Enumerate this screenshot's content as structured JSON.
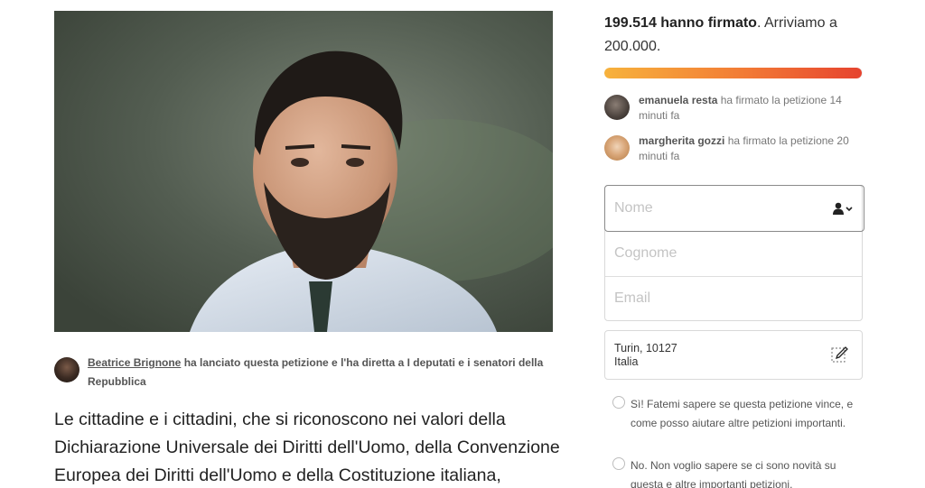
{
  "petition": {
    "starter_name": "Beatrice Brignone",
    "starter_action": " ha lanciato questa petizione e l'ha diretta a I deputati e i senatori della Repubblica",
    "body_text": "Le cittadine e i cittadini, che si riconoscono nei valori della Dichiarazione Universale dei Diritti dell'Uomo, della Convenzione Europea dei Diritti dell'Uomo e della Costituzione italiana,"
  },
  "signatures": {
    "count": "199.514 hanno firmato",
    "goal_text": ". Arriviamo a 200.000.",
    "progress_fraction": 0.99757
  },
  "recent_signers": [
    {
      "name": "emanuela resta",
      "action": " ha firmato la petizione 14 minuti fa"
    },
    {
      "name": "margherita gozzi",
      "action": " ha firmato la petizione 20 minuti fa"
    }
  ],
  "form": {
    "first_name_placeholder": "Nome",
    "last_name_placeholder": "Cognome",
    "email_placeholder": "Email",
    "location_line1": "Turin, 10127",
    "location_line2": "Italia"
  },
  "options": [
    {
      "label": "Sì! Fatemi sapere se questa petizione vince, e come posso aiutare altre petizioni importanti."
    },
    {
      "label": "No. Non voglio sapere se ci sono novità su questa e altre importanti petizioni."
    }
  ],
  "icons": {
    "user": "user-icon",
    "edit": "edit-icon"
  },
  "colors": {
    "progress_start": "#f7b23c",
    "progress_end": "#e6432f"
  }
}
